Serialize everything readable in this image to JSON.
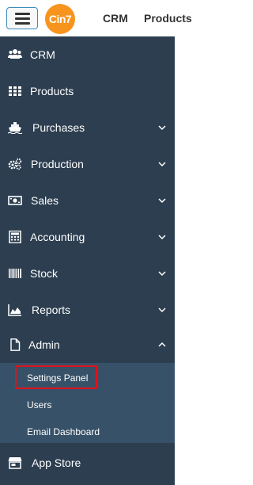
{
  "header": {
    "logo_text": "Cin7",
    "links": [
      "CRM",
      "Products"
    ]
  },
  "sidebar": {
    "items": [
      {
        "label": "CRM",
        "icon": "users-icon",
        "has_chevron": false
      },
      {
        "label": "Products",
        "icon": "grid-icon",
        "has_chevron": false
      },
      {
        "label": "Purchases",
        "icon": "ship-icon",
        "has_chevron": true
      },
      {
        "label": "Production",
        "icon": "gears-icon",
        "has_chevron": true
      },
      {
        "label": "Sales",
        "icon": "money-icon",
        "has_chevron": true
      },
      {
        "label": "Accounting",
        "icon": "calculator-icon",
        "has_chevron": true
      },
      {
        "label": "Stock",
        "icon": "barcode-icon",
        "has_chevron": true
      },
      {
        "label": "Reports",
        "icon": "area-chart-icon",
        "has_chevron": true
      },
      {
        "label": "Admin",
        "icon": "file-icon",
        "has_chevron": true,
        "expanded": true
      }
    ],
    "admin_submenu": [
      {
        "label": "Settings Panel",
        "highlighted": true
      },
      {
        "label": "Users"
      },
      {
        "label": "Email Dashboard"
      }
    ],
    "bottom_item": {
      "label": "App Store",
      "icon": "store-icon"
    }
  },
  "colors": {
    "sidebar_bg": "#2c3e50",
    "submenu_bg": "#375168",
    "logo": "#f7941d",
    "highlight": "#e0121b",
    "hamburger_border": "#3c8dbc"
  }
}
